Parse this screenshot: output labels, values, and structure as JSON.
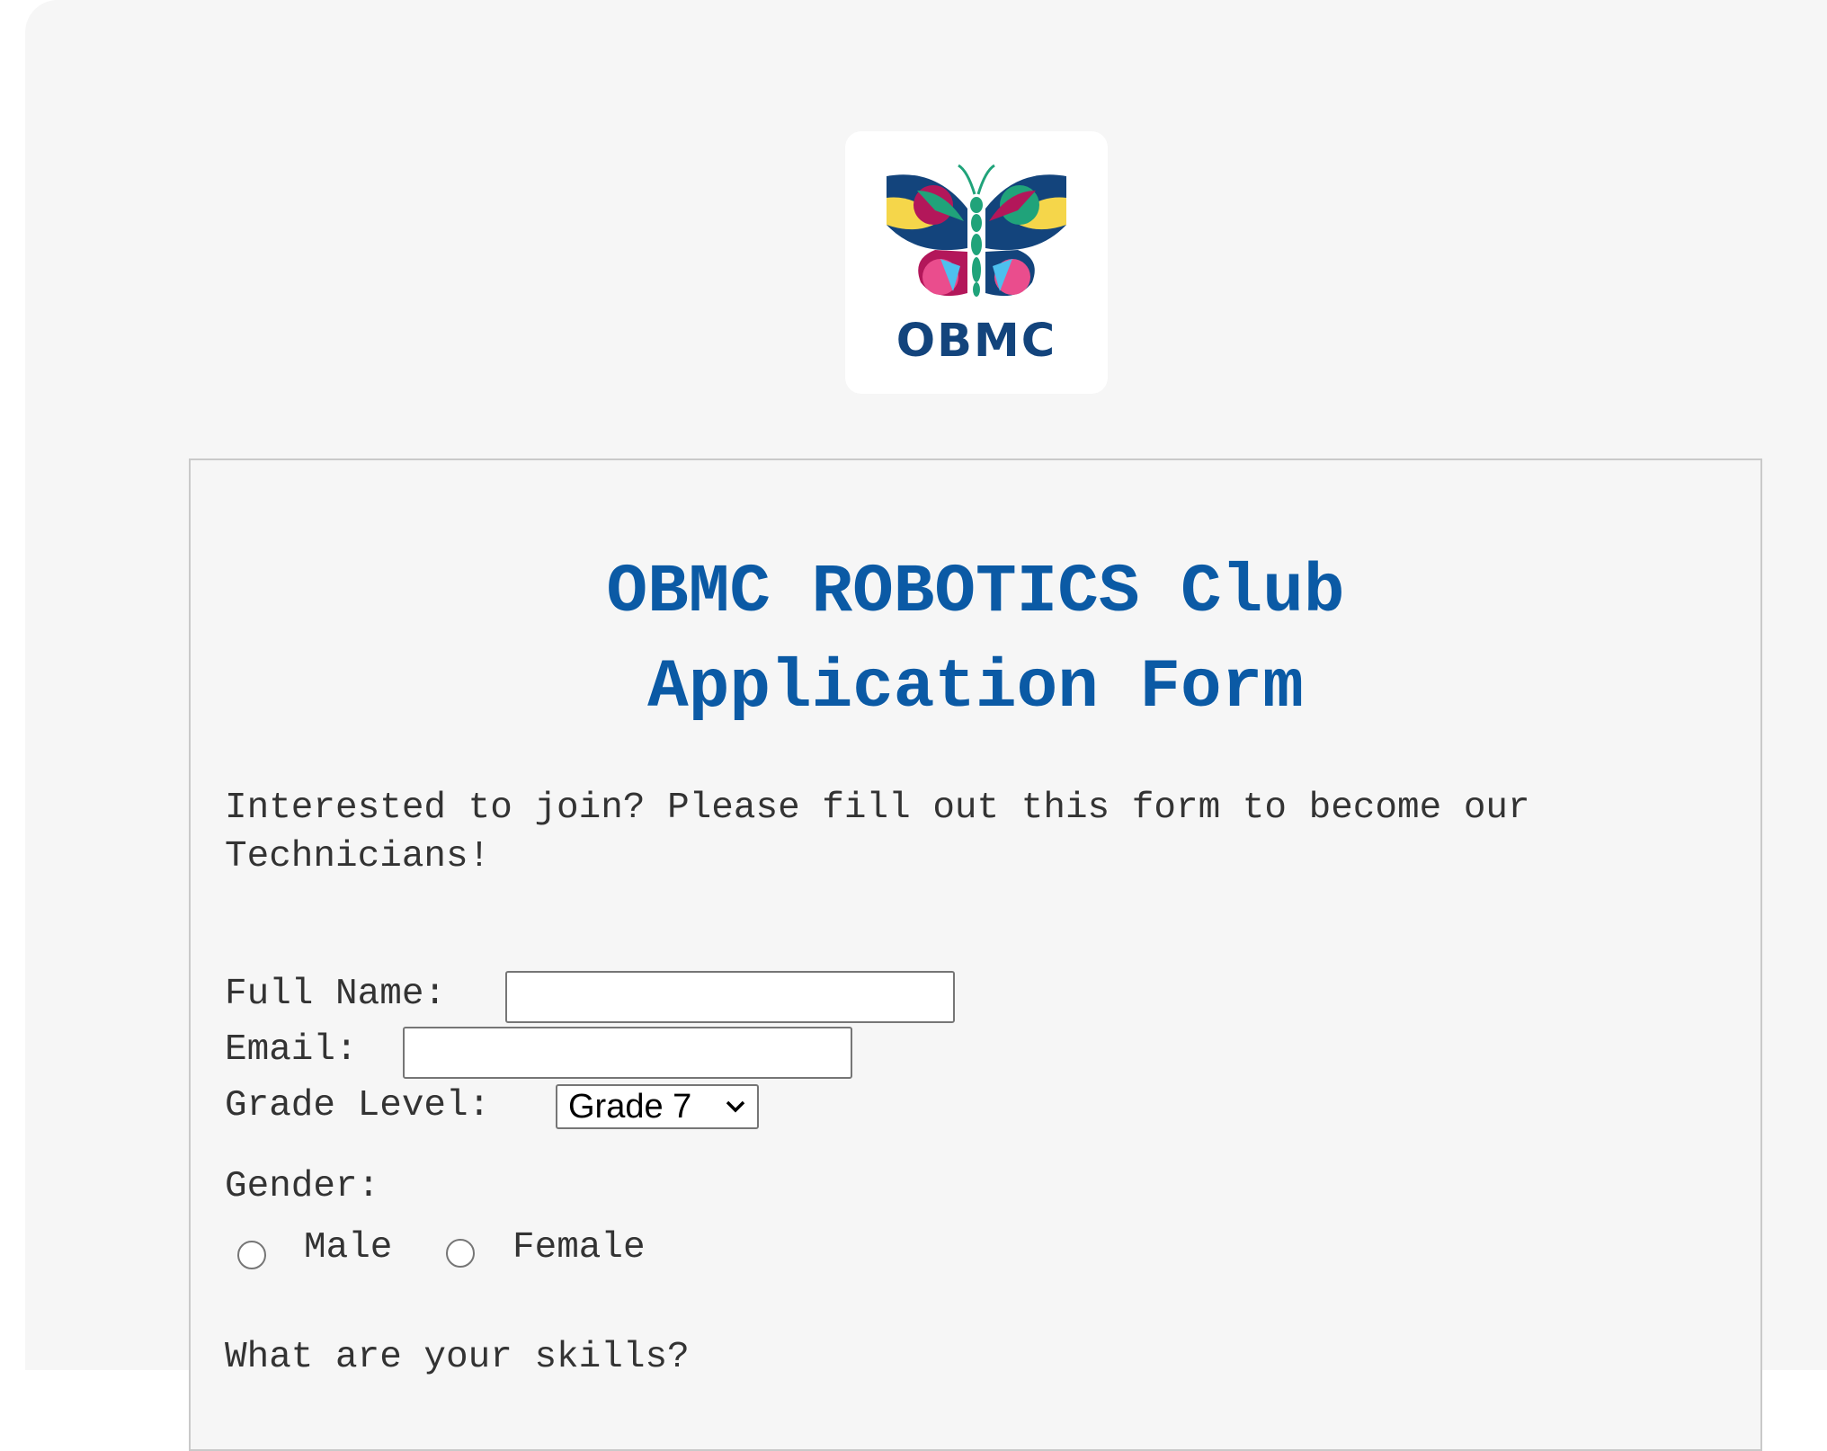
{
  "logo": {
    "text": "OBMC",
    "colors": {
      "navy": "#13447c",
      "green": "#20a37a",
      "magenta": "#b3175a",
      "yellow": "#f5d64a",
      "pink": "#ea4d8d",
      "cyan": "#4dc0ee"
    },
    "icon": "butterfly-icon"
  },
  "form": {
    "title_line1": "OBMC ROBOTICS Club",
    "title_line2": "Application Form",
    "intro": "Interested to join? Please fill out this form to become our Technicians!",
    "full_name_label": "Full Name:",
    "full_name_value": "",
    "email_label": "Email:",
    "email_value": "",
    "grade_level_label": "Grade Level:",
    "grade_level_selected": "Grade 7",
    "gender_label": "Gender:",
    "gender_options": [
      "Male",
      "Female"
    ],
    "skills_label": "What are your skills?"
  },
  "theme": {
    "title_color": "#0b5aa5",
    "background": "#f6f6f6"
  }
}
